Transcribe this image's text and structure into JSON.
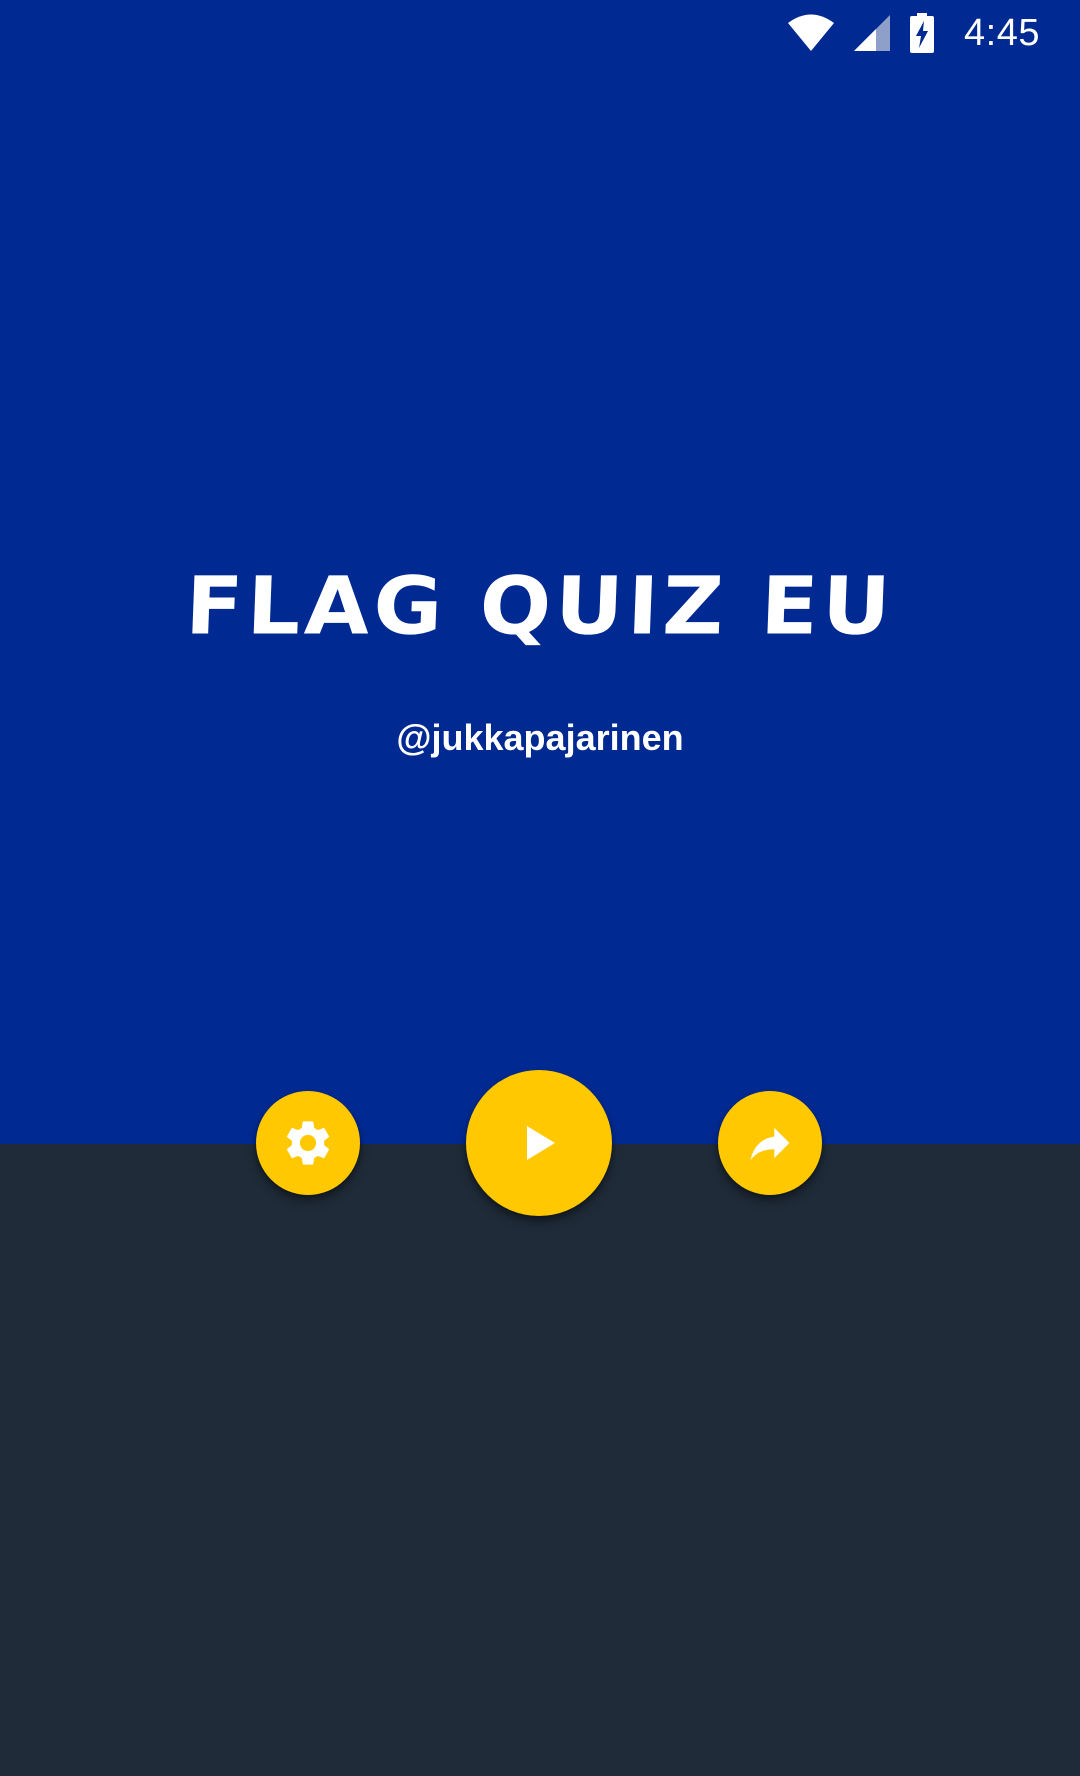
{
  "status_bar": {
    "time": "4:45",
    "icons": [
      "wifi-icon",
      "cell-signal-icon",
      "battery-charging-icon"
    ]
  },
  "main": {
    "title": "FLAG QUIZ EU",
    "author": "@jukkapajarinen"
  },
  "actions": {
    "settings_icon": "gear-icon",
    "play_icon": "play-icon",
    "share_icon": "share-arrow-icon"
  },
  "colors": {
    "top_background": "#002a92",
    "bottom_background": "#1f2b38",
    "accent": "#ffc800",
    "text": "#ffffff"
  }
}
